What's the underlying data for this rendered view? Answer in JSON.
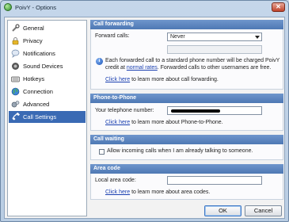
{
  "window": {
    "title": "PoivY - Options"
  },
  "sidebar": {
    "items": [
      {
        "label": "General",
        "icon": "wrench-icon"
      },
      {
        "label": "Privacy",
        "icon": "lock-icon"
      },
      {
        "label": "Notifications",
        "icon": "speech-bubble-icon"
      },
      {
        "label": "Sound Devices",
        "icon": "speaker-icon"
      },
      {
        "label": "Hotkeys",
        "icon": "keyboard-icon"
      },
      {
        "label": "Connection",
        "icon": "globe-icon"
      },
      {
        "label": "Advanced",
        "icon": "gears-icon"
      },
      {
        "label": "Call Settings",
        "icon": "telephone-icon",
        "selected": true
      }
    ]
  },
  "call_forwarding": {
    "heading": "Call forwarding",
    "forward_label": "Forward calls:",
    "forward_value": "Never",
    "number_value": "",
    "info_text_1": "Each forwarded call to a standard phone number will be charged PoivY",
    "info_text_2a": "credit at ",
    "info_link": "normal rates",
    "info_text_2b": ". Forwarded calls to other usernames are free.",
    "click_here": "Click here",
    "learn_more": " to learn more about call forwarding."
  },
  "phone_to_phone": {
    "heading": "Phone-to-Phone",
    "number_label": "Your telephone number:",
    "click_here": "Click here",
    "learn_more": " to learn more about Phone-to-Phone."
  },
  "call_waiting": {
    "heading": "Call waiting",
    "checkbox_label": "Allow incoming calls when I am already talking to someone.",
    "checked": false
  },
  "area_code": {
    "heading": "Area code",
    "local_label": "Local area code:",
    "local_value": "",
    "click_here": "Click here",
    "learn_more": " to learn more about area codes."
  },
  "buttons": {
    "ok": "OK",
    "cancel": "Cancel"
  },
  "colors": {
    "section_header": "#4e78b4",
    "selected_item": "#3a6ab4",
    "link": "#1a3fb0"
  }
}
